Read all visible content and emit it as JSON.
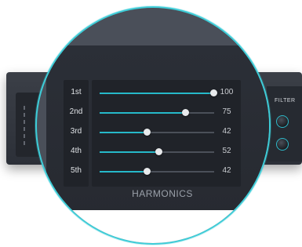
{
  "background": {
    "filter_label": "FILTER"
  },
  "harmonics": {
    "title": "HARMONICS",
    "items": [
      {
        "label": "1st",
        "value": "100",
        "fraction": 1.0
      },
      {
        "label": "2nd",
        "value": "75",
        "fraction": 0.75
      },
      {
        "label": "3rd",
        "value": "42",
        "fraction": 0.42
      },
      {
        "label": "4th",
        "value": "52",
        "fraction": 0.52
      },
      {
        "label": "5th",
        "value": "42",
        "fraction": 0.42
      }
    ]
  },
  "colors": {
    "accent": "#26b9c9",
    "ring": "#3ecdd8",
    "panel": "#2b2f37"
  }
}
